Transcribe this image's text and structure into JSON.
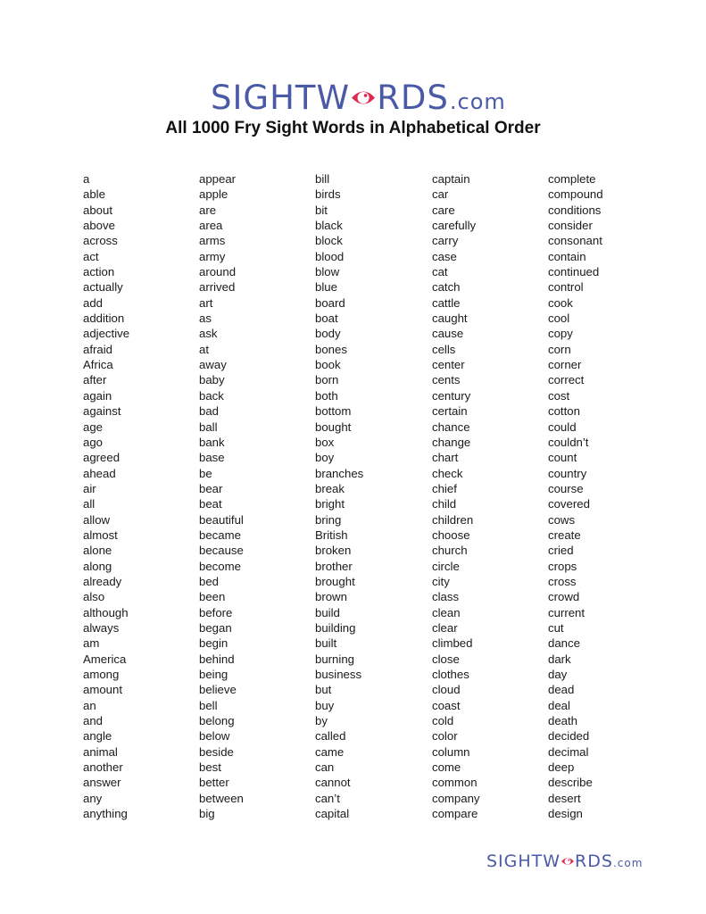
{
  "header": {
    "logo_main": "SIGHTW",
    "logo_eye_letter": "O",
    "logo_rest": "RDS",
    "logo_domain": ".com",
    "title": "All 1000 Fry Sight Words in Alphabetical Order"
  },
  "colors": {
    "logo_blue": "#4a5aa6",
    "logo_red": "#e0284f"
  },
  "columns": [
    [
      "a",
      "able",
      "about",
      "above",
      "across",
      "act",
      "action",
      "actually",
      "add",
      "addition",
      "adjective",
      "afraid",
      "Africa",
      "after",
      "again",
      "against",
      "age",
      "ago",
      "agreed",
      "ahead",
      "air",
      "all",
      "allow",
      "almost",
      "alone",
      "along",
      "already",
      "also",
      "although",
      "always",
      "am",
      "America",
      "among",
      "amount",
      "an",
      "and",
      "angle",
      "animal",
      "another",
      "answer",
      "any",
      "anything"
    ],
    [
      "appear",
      "apple",
      "are",
      "area",
      "arms",
      "army",
      "around",
      "arrived",
      "art",
      "as",
      "ask",
      "at",
      "away",
      "baby",
      "back",
      "bad",
      "ball",
      "bank",
      "base",
      "be",
      "bear",
      "beat",
      "beautiful",
      "became",
      "because",
      "become",
      "bed",
      "been",
      "before",
      "began",
      "begin",
      "behind",
      "being",
      "believe",
      "bell",
      "belong",
      "below",
      "beside",
      "best",
      "better",
      "between",
      "big"
    ],
    [
      "bill",
      "birds",
      "bit",
      "black",
      "block",
      "blood",
      "blow",
      "blue",
      "board",
      "boat",
      "body",
      "bones",
      "book",
      "born",
      "both",
      "bottom",
      "bought",
      "box",
      "boy",
      "branches",
      "break",
      "bright",
      "bring",
      "British",
      "broken",
      "brother",
      "brought",
      "brown",
      "build",
      "building",
      "built",
      "burning",
      "business",
      "but",
      "buy",
      "by",
      "called",
      "came",
      "can",
      "cannot",
      "can’t",
      "capital"
    ],
    [
      "captain",
      "car",
      "care",
      "carefully",
      "carry",
      "case",
      "cat",
      "catch",
      "cattle",
      "caught",
      "cause",
      "cells",
      "center",
      "cents",
      "century",
      "certain",
      "chance",
      "change",
      "chart",
      "check",
      "chief",
      "child",
      "children",
      "choose",
      "church",
      "circle",
      "city",
      "class",
      "clean",
      "clear",
      "climbed",
      "close",
      "clothes",
      "cloud",
      "coast",
      "cold",
      "color",
      "column",
      "come",
      "common",
      "company",
      "compare"
    ],
    [
      "complete",
      "compound",
      "conditions",
      "consider",
      "consonant",
      "contain",
      "continued",
      "control",
      "cook",
      "cool",
      "copy",
      "corn",
      "corner",
      "correct",
      "cost",
      "cotton",
      "could",
      "couldn’t",
      "count",
      "country",
      "course",
      "covered",
      "cows",
      "create",
      "cried",
      "crops",
      "cross",
      "crowd",
      "current",
      "cut",
      "dance",
      "dark",
      "day",
      "dead",
      "deal",
      "death",
      "decided",
      "decimal",
      "deep",
      "describe",
      "desert",
      "design"
    ]
  ],
  "footer": {
    "logo_main": "SIGHTW",
    "logo_eye_letter": "O",
    "logo_rest": "RDS",
    "logo_domain": ".com"
  }
}
